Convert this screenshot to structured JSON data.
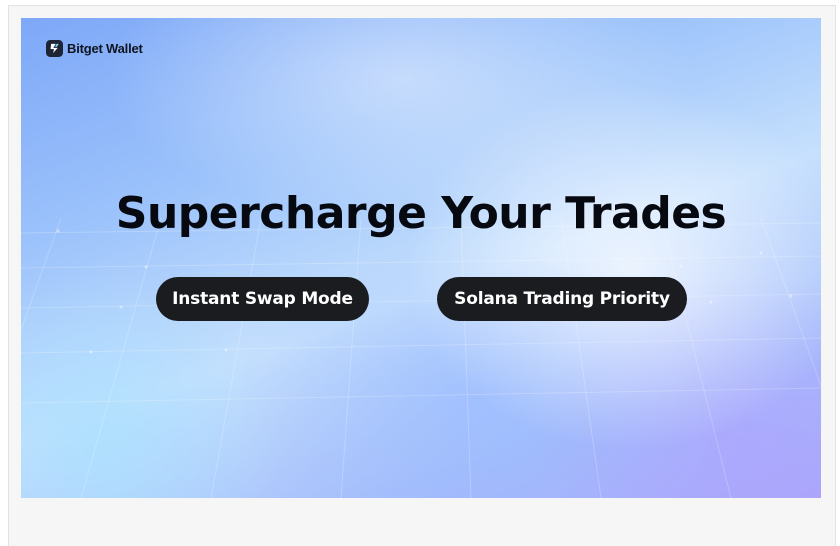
{
  "brand": {
    "name": "Bitget Wallet",
    "icon": "bitget-logo-icon",
    "icon_color": "#1d2535"
  },
  "banner": {
    "headline": "Supercharge Your Trades",
    "features": [
      {
        "label": "Instant Swap Mode"
      },
      {
        "label": "Solana Trading Priority"
      }
    ],
    "colors": {
      "headline": "#06090f",
      "pill_background": "#1a1c20",
      "pill_text": "#ffffff",
      "gradient_blue": "#7ea8f8",
      "gradient_light": "#c6e0fd",
      "gradient_violet": "#a9a8fb"
    }
  }
}
